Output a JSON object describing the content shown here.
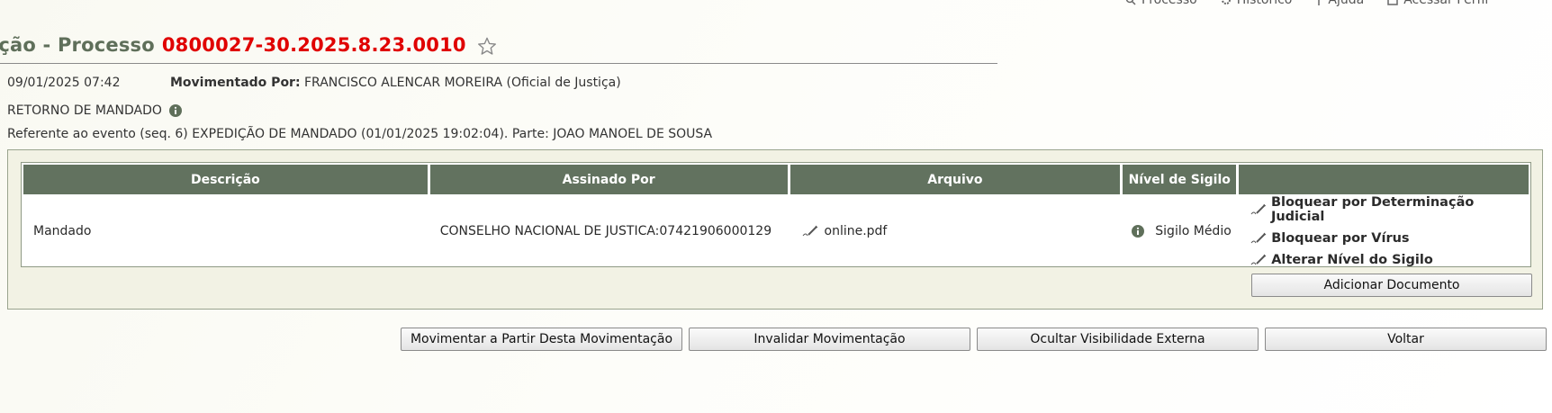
{
  "topnav": {
    "items": [
      {
        "label": "Processo",
        "icon": "search-icon"
      },
      {
        "label": "Histórico",
        "icon": "gear-icon"
      },
      {
        "label": "Ajuda",
        "icon": "help-icon"
      },
      {
        "label": "Acessar Perfil",
        "icon": "user-icon"
      }
    ]
  },
  "header": {
    "title_prefix": "ação - Processo",
    "process_number": "0800027-30.2025.8.23.0010"
  },
  "movement": {
    "date": "09/01/2025 07:42",
    "moved_by_label": "Movimentado Por:",
    "moved_by": "FRANCISCO ALENCAR MOREIRA (Oficial de Justiça)",
    "type": "RETORNO DE MANDADO",
    "reference": "Referente ao evento (seq. 6) EXPEDIÇÃO DE MANDADO (01/01/2025 19:02:04). Parte: JOAO MANOEL DE SOUSA"
  },
  "table": {
    "headers": [
      "Descrição",
      "Assinado Por",
      "Arquivo",
      "Nível de Sigilo",
      ""
    ],
    "rows": [
      {
        "descricao": "Mandado",
        "assinado_por": "CONSELHO NACIONAL DE JUSTICA:07421906000129",
        "arquivo": "online.pdf",
        "sigilo": "Sigilo Médio",
        "actions": [
          "Bloquear por Determinação Judicial",
          "Bloquear por Vírus",
          "Alterar Nível do Sigilo"
        ]
      }
    ]
  },
  "buttons": {
    "add_document": "Adicionar Documento",
    "movimentar": "Movimentar a Partir Desta Movimentação",
    "invalidar": "Invalidar Movimentação",
    "ocultar": "Ocultar Visibilidade Externa",
    "voltar": "Voltar"
  },
  "colors": {
    "title_green": "#5f6f5a",
    "process_red": "#e00000",
    "header_bg": "#62725f",
    "panel_bg": "#f2f2e4"
  }
}
